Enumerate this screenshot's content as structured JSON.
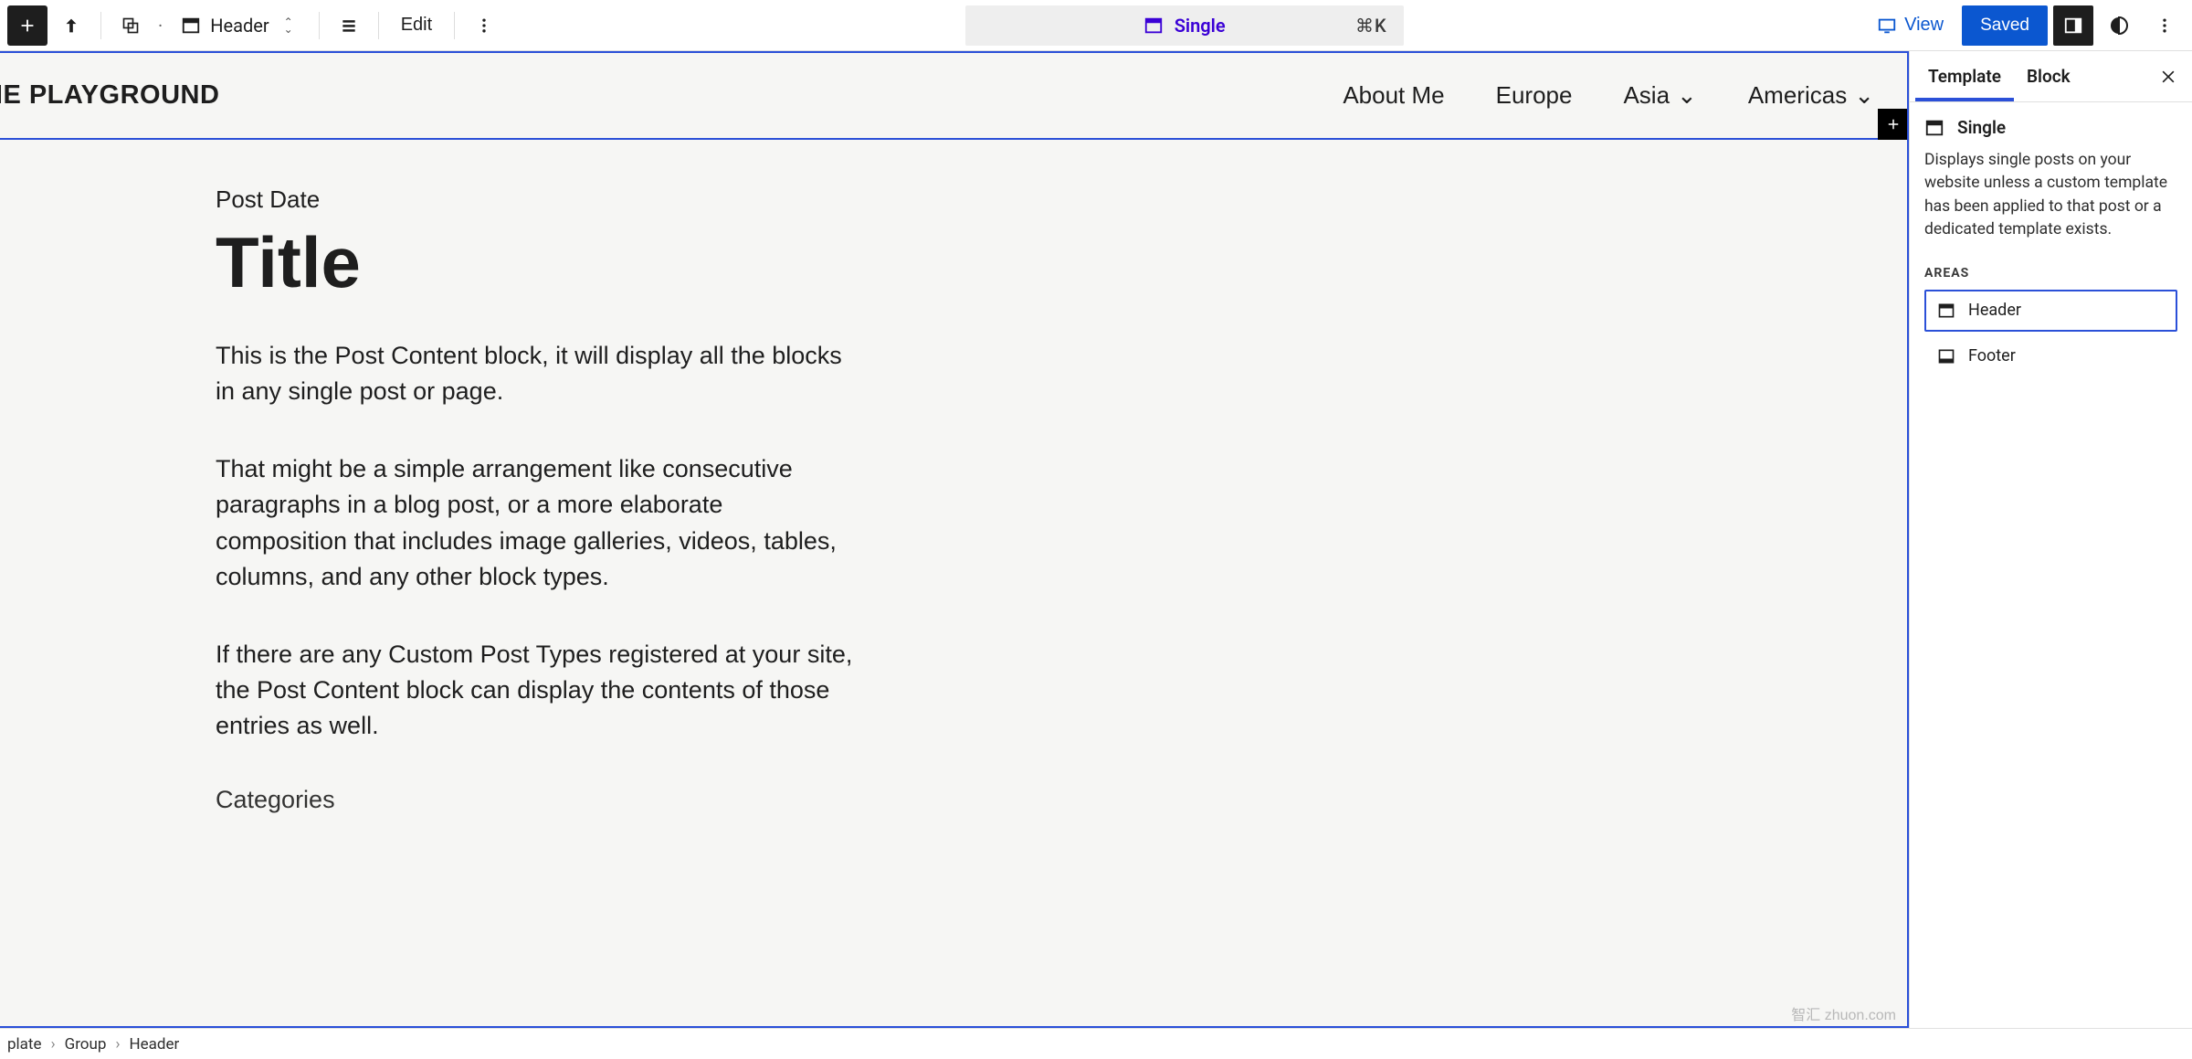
{
  "toolbar": {
    "block_label": "Header",
    "edit_label": "Edit",
    "document": {
      "name": "Single",
      "shortcut": "⌘K"
    },
    "view_label": "View",
    "saved_label": "Saved"
  },
  "site": {
    "title": "HE PLAYGROUND",
    "nav": [
      {
        "label": "About Me",
        "has_submenu": false
      },
      {
        "label": "Europe",
        "has_submenu": false
      },
      {
        "label": "Asia",
        "has_submenu": true
      },
      {
        "label": "Americas",
        "has_submenu": true
      }
    ]
  },
  "post": {
    "date_label": "Post Date",
    "title": "Title",
    "paragraphs": [
      "This is the Post Content block, it will display all the blocks in any single post or page.",
      "That might be a simple arrangement like consecutive paragraphs in a blog post, or a more elaborate composition that includes image galleries, videos, tables, columns, and any other block types.",
      "If there are any Custom Post Types registered at your site, the Post Content block can display the contents of those entries as well."
    ],
    "categories_label": "Categories"
  },
  "settings": {
    "tabs": {
      "template": "Template",
      "block": "Block"
    },
    "template": {
      "name": "Single",
      "description": "Displays single posts on your website unless a custom template has been applied to that post or a dedicated template exists.",
      "areas_label": "AREAS",
      "areas": [
        {
          "label": "Header",
          "selected": true
        },
        {
          "label": "Footer",
          "selected": false
        }
      ]
    }
  },
  "breadcrumb": [
    "plate",
    "Group",
    "Header"
  ],
  "watermark": "智汇 zhuon.com"
}
